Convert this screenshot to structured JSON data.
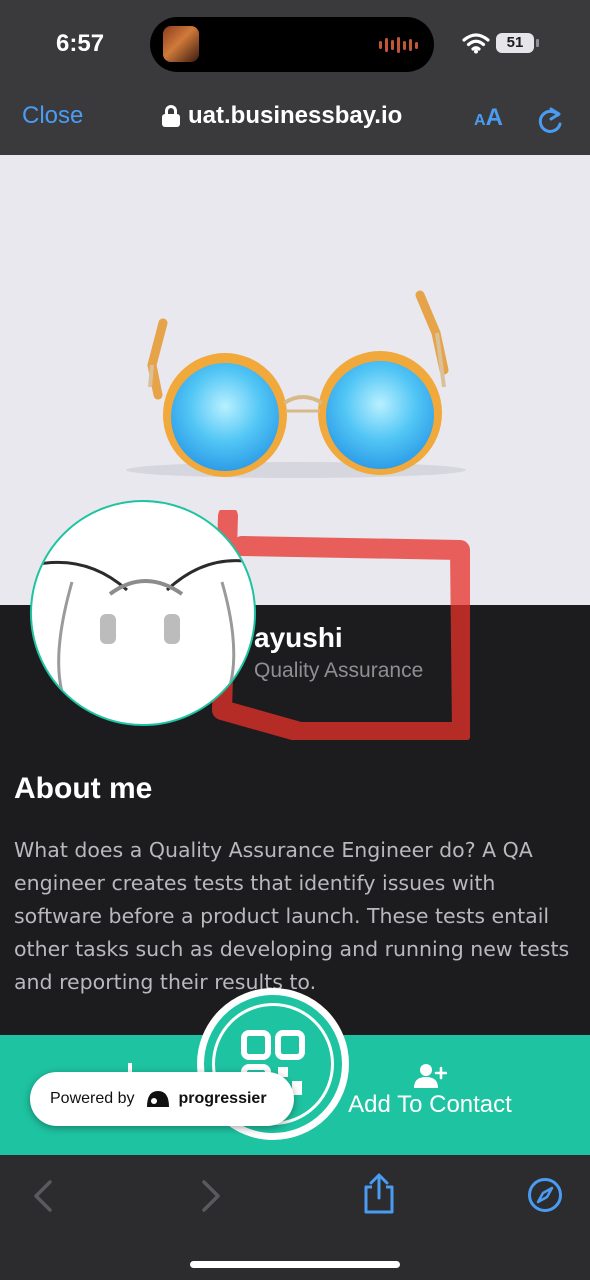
{
  "status_bar": {
    "time": "6:57",
    "battery": "51"
  },
  "browser": {
    "close_label": "Close",
    "url": "uat.businessbay.io",
    "text_size_small": "A",
    "text_size_big": "A"
  },
  "profile": {
    "name": "ayushi",
    "role": "Quality Assurance",
    "about_heading": "About me",
    "about_text": "What does a Quality Assurance Engineer do? A QA engineer creates tests that identify issues with software before a product launch. These tests entail other tasks such as developing and running new tests and reporting their results to."
  },
  "actions": {
    "add_contact_label": "Add To Contact"
  },
  "powered_by": {
    "label": "Powered by",
    "brand": "progressier"
  },
  "colors": {
    "accent": "#1ec3a1",
    "link_blue": "#4a9cf3",
    "annotation_red": "#e8302a"
  },
  "icons": [
    "lock-icon",
    "wifi-icon",
    "battery-icon",
    "reload-icon",
    "person-add-icon",
    "qr-code-icon",
    "back-icon",
    "forward-icon",
    "share-icon",
    "compass-icon"
  ]
}
